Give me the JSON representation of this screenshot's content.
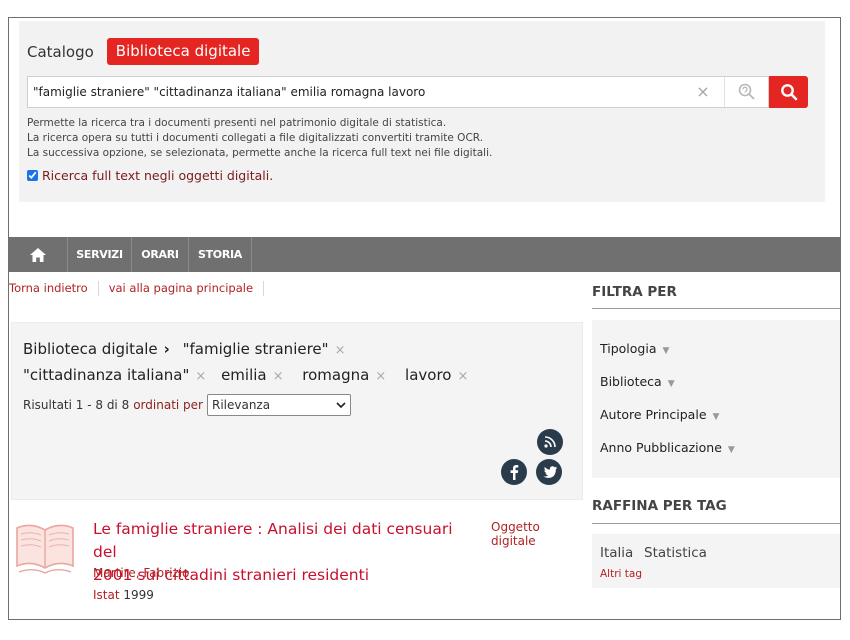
{
  "search": {
    "tab_catalog": "Catalogo",
    "tab_digital": "Biblioteca digitale",
    "query": "\"famiglie straniere\" \"cittadinanza italiana\" emilia romagna lavoro",
    "clear_glyph": "×",
    "help_lines": [
      "Permette la ricerca tra i documenti presenti nel patrimonio digitale di statistica.",
      "La ricerca opera su tutti i documenti collegati a file digitalizzati convertiti tramite OCR.",
      "La successiva opzione, se selezionata, permette anche la ricerca full text nei file digitali."
    ],
    "fulltext_label": "Ricerca full text negli oggetti digitali.",
    "fulltext_checked": true
  },
  "nav": {
    "servizi": "SERVIZI",
    "orari": "ORARI",
    "storia": "STORIA"
  },
  "links": {
    "back": "Torna indietro",
    "main": "vai alla pagina principale"
  },
  "results": {
    "crumb_root": "Biblioteca digitale",
    "terms": [
      "\"famiglie straniere\"",
      "\"cittadinanza italiana\"",
      "emilia",
      "romagna",
      "lavoro"
    ],
    "remove_glyph": "×",
    "summary": "Risultati 1 - 8 di 8",
    "order_label": "ordinati per",
    "sort_value": "Rilevanza"
  },
  "result_item": {
    "title_line1": "Le famiglie straniere : Analisi dei dati censuari del",
    "title_line2": "2001 sui cittadini stranieri residenti",
    "type": "Oggetto digitale",
    "author": "Martire, Fabrizio",
    "publisher": "Istat",
    "year": "1999"
  },
  "filters": {
    "heading": "FILTRA PER",
    "items": [
      "Tipologia",
      "Biblioteca",
      "Autore Principale",
      "Anno Pubblicazione"
    ],
    "caret": "▼"
  },
  "tags": {
    "heading": "RAFFINA PER TAG",
    "items": [
      "Italia",
      "Statistica"
    ],
    "other": "Altri tag"
  },
  "colors": {
    "accent": "#e52521",
    "link": "#b22222",
    "nav_bg": "#707070",
    "panel_bg": "#f2f2f2"
  },
  "icons": {
    "home": "home-icon",
    "advanced": "advanced-search-icon",
    "search": "search-icon",
    "rss": "rss-icon",
    "facebook": "facebook-icon",
    "twitter": "twitter-icon",
    "book": "book-icon"
  }
}
